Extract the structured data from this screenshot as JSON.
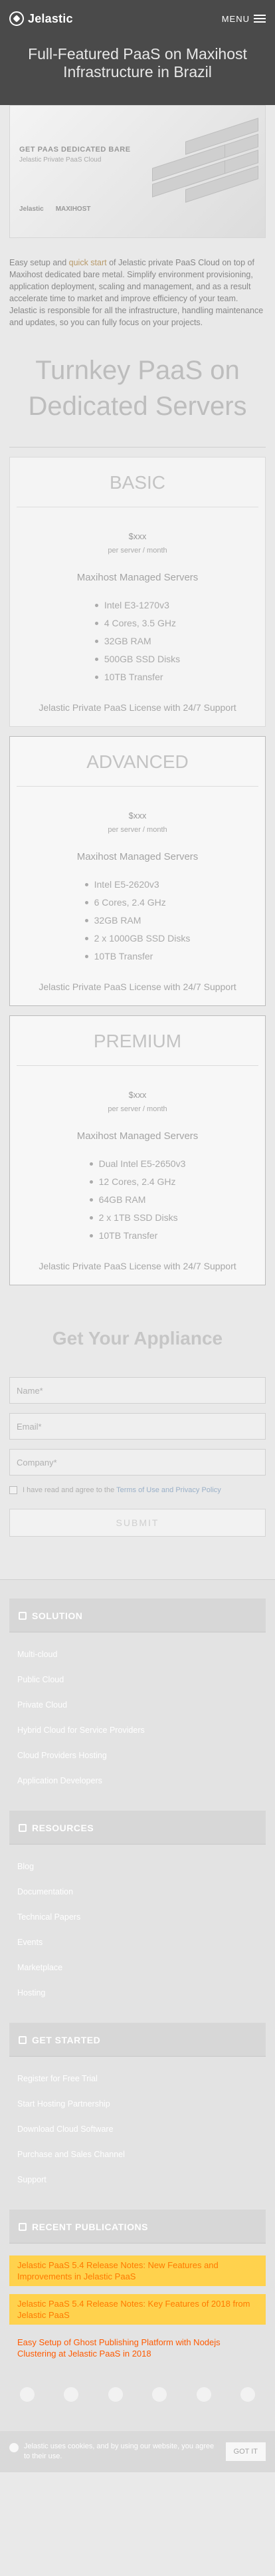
{
  "header": {
    "logo": "Jelastic",
    "menu_label": "MENU"
  },
  "hero": {
    "title": "Full-Featured PaaS on Maxihost Infrastructure in Brazil"
  },
  "banner": {
    "title": "GET PAAS DEDICATED BARE",
    "subtitle": "Jelastic Private PaaS Cloud",
    "logo_left": "Jelastic",
    "logo_right": "MAXIHOST"
  },
  "intro": {
    "text_before": "Easy setup and ",
    "highlight": "quick start",
    "text_after": " of Jelastic private PaaS Cloud on top of Maxihost dedicated bare metal. Simplify environment provisioning, application deployment, scaling and management, and as a result accelerate time to market and improve efficiency of your team. Jelastic is responsible for all the infrastructure, handling maintenance and updates, so you can fully focus on your projects."
  },
  "section_title": "Turnkey PaaS on Dedicated Servers",
  "plans": [
    {
      "name": "BASIC",
      "price": "$xxx",
      "per": "per server / month",
      "managed": "Maxihost Managed Servers",
      "specs": [
        "Intel E3-1270v3",
        "4 Cores, 3.5 GHz",
        "32GB RAM",
        "500GB SSD Disks",
        "10TB Transfer"
      ],
      "license": "Jelastic Private PaaS License with 24/7 Support"
    },
    {
      "name": "ADVANCED",
      "price": "$xxx",
      "per": "per server / month",
      "managed": "Maxihost Managed Servers",
      "specs": [
        "Intel E5-2620v3",
        "6 Cores, 2.4 GHz",
        "32GB RAM",
        "2 x 1000GB SSD Disks",
        "10TB Transfer"
      ],
      "license": "Jelastic Private PaaS License with 24/7 Support"
    },
    {
      "name": "PREMIUM",
      "price": "$xxx",
      "per": "per server / month",
      "managed": "Maxihost Managed Servers",
      "specs": [
        "Dual Intel E5-2650v3",
        "12 Cores, 2.4 GHz",
        "64GB RAM",
        "2 x 1TB SSD Disks",
        "10TB Transfer"
      ],
      "license": "Jelastic Private PaaS License with 24/7 Support"
    }
  ],
  "form": {
    "title": "Get Your Appliance",
    "name_placeholder": "Name*",
    "email_placeholder": "Email*",
    "company_placeholder": "Company*",
    "agree_before": "I have read and agree to the ",
    "agree_link": "Terms of Use and Privacy Policy",
    "agree_after": "",
    "submit": "SUBMIT"
  },
  "footer": {
    "solution": {
      "title": "SOLUTION",
      "items": [
        "Multi-cloud",
        "Public Cloud",
        "Private Cloud",
        "Hybrid Cloud for Service Providers",
        "Cloud Providers Hosting",
        "Application Developers"
      ]
    },
    "resources": {
      "title": "RESOURCES",
      "items": [
        "Blog",
        "Documentation",
        "Technical Papers",
        "Events",
        "Marketplace",
        "Hosting"
      ]
    },
    "get_started": {
      "title": "GET STARTED",
      "items": [
        "Register for Free Trial",
        "Start Hosting Partnership",
        "Download Cloud Software",
        "Purchase and Sales Channel",
        "Support"
      ]
    },
    "publications": {
      "title": "RECENT PUBLICATIONS",
      "items": [
        "Jelastic PaaS 5.4 Release Notes: New Features and Improvements in Jelastic PaaS",
        "Jelastic PaaS 5.4 Release Notes: Key Features of 2018 from Jelastic PaaS",
        "Easy Setup of Ghost Publishing Platform with Nodejs Clustering at Jelastic PaaS in 2018"
      ]
    }
  },
  "cookie": {
    "text": "Jelastic uses cookies, and by using our website, you agree to their use.",
    "button": "GOT IT"
  }
}
